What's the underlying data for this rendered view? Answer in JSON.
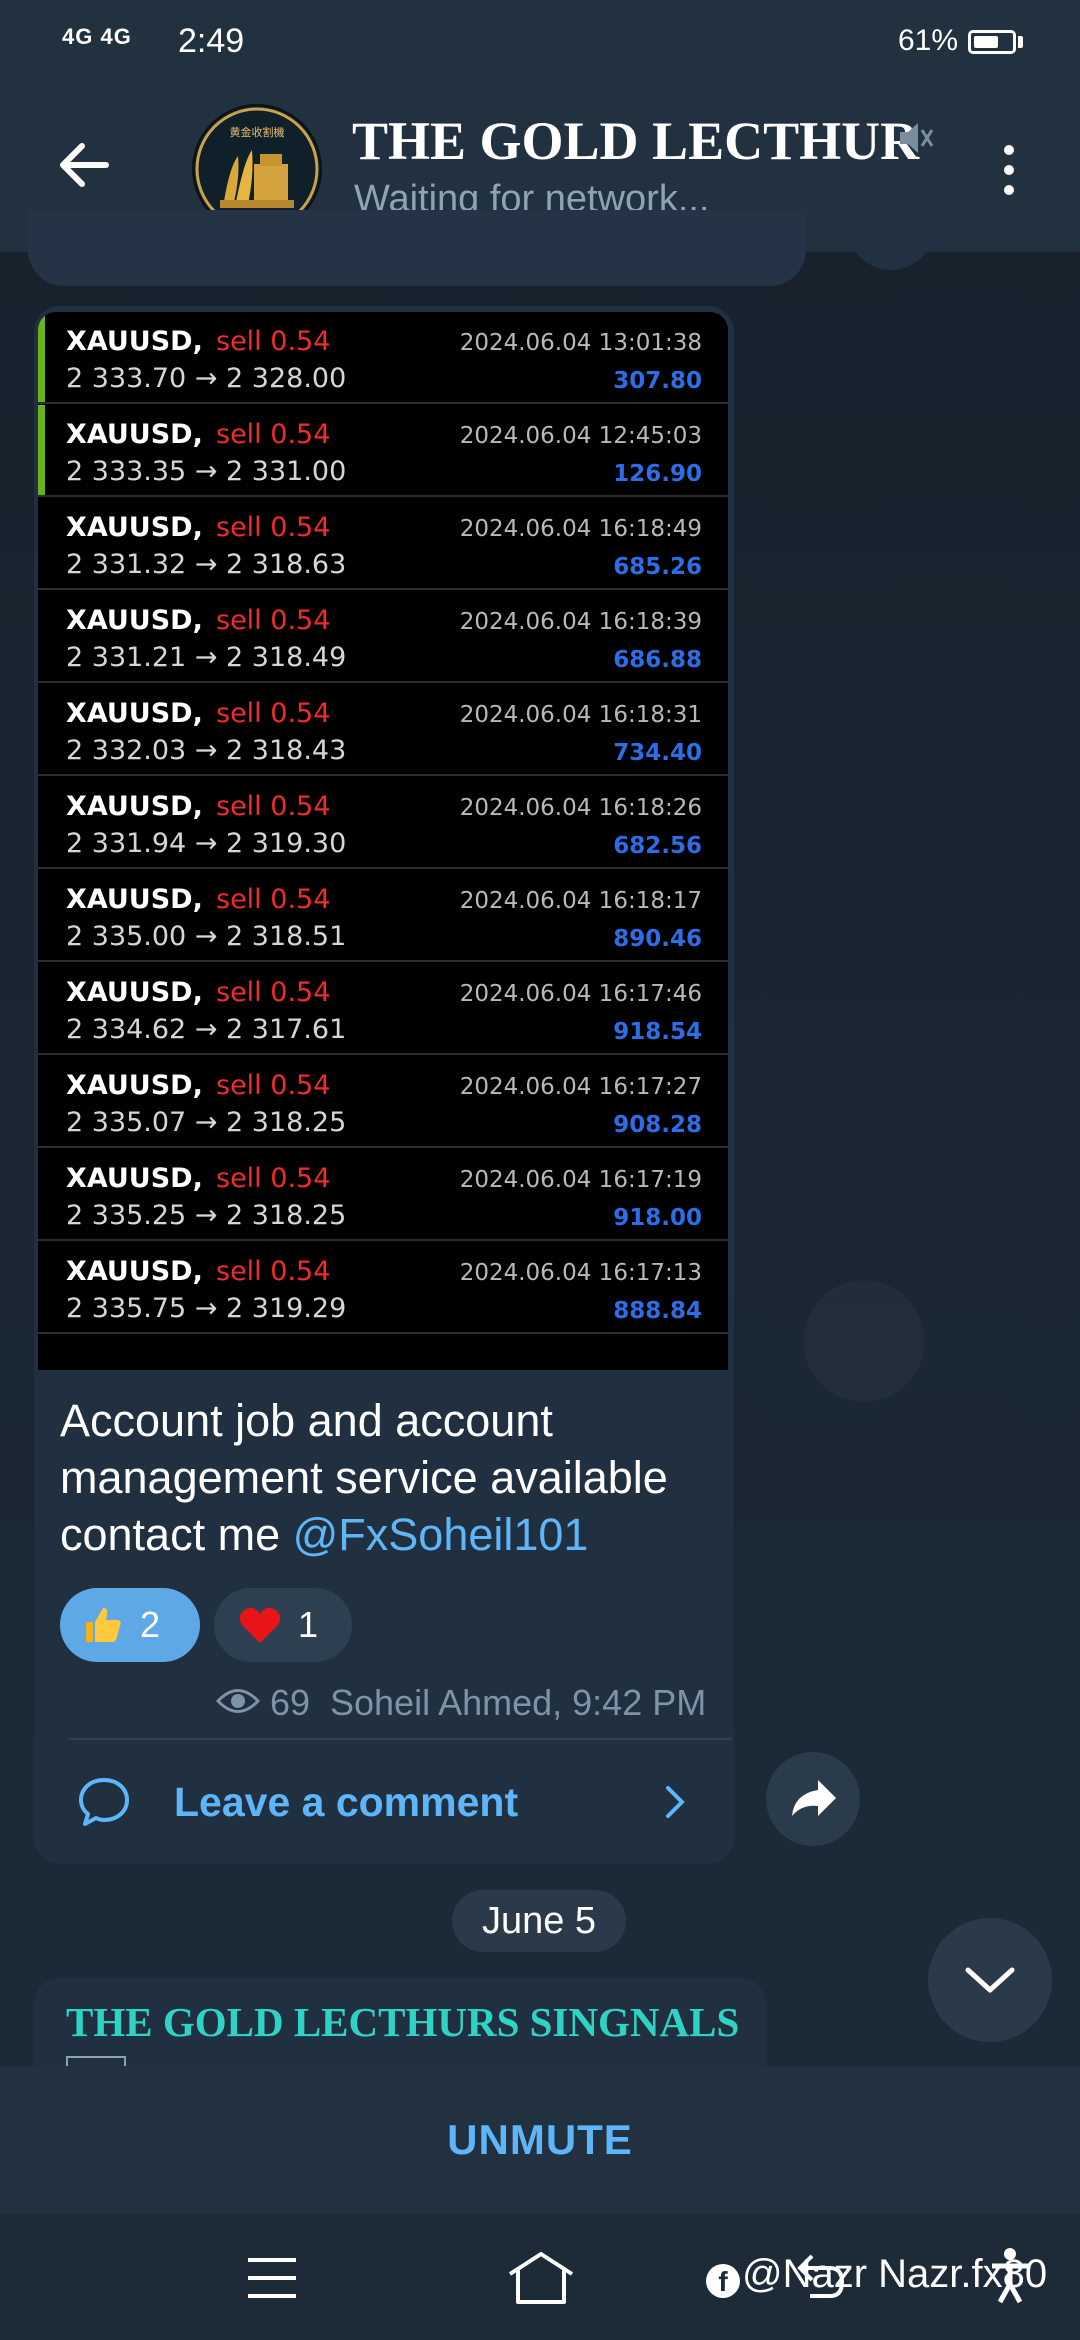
{
  "status_bar": {
    "network": "4G 4G",
    "time": "2:49",
    "battery_percent": "61%",
    "battery_level": 0.61
  },
  "header": {
    "channel_title": "THE GOLD LECTHURS",
    "channel_status": "Waiting for network...",
    "avatar_caption": "黄金收割機"
  },
  "trades": [
    {
      "symbol": "XAUUSD,",
      "side": "sell 0.54",
      "prices": "2 333.70 → 2 328.00",
      "time": "2024.06.04 13:01:38",
      "profit": "307.80",
      "marker": "green"
    },
    {
      "symbol": "XAUUSD,",
      "side": "sell 0.54",
      "prices": "2 333.35 → 2 331.00",
      "time": "2024.06.04 12:45:03",
      "profit": "126.90",
      "marker": "green"
    },
    {
      "symbol": "XAUUSD,",
      "side": "sell 0.54",
      "prices": "2 331.32 → 2 318.63",
      "time": "2024.06.04 16:18:49",
      "profit": "685.26",
      "marker": ""
    },
    {
      "symbol": "XAUUSD,",
      "side": "sell 0.54",
      "prices": "2 331.21 → 2 318.49",
      "time": "2024.06.04 16:18:39",
      "profit": "686.88",
      "marker": ""
    },
    {
      "symbol": "XAUUSD,",
      "side": "sell 0.54",
      "prices": "2 332.03 → 2 318.43",
      "time": "2024.06.04 16:18:31",
      "profit": "734.40",
      "marker": ""
    },
    {
      "symbol": "XAUUSD,",
      "side": "sell 0.54",
      "prices": "2 331.94 → 2 319.30",
      "time": "2024.06.04 16:18:26",
      "profit": "682.56",
      "marker": ""
    },
    {
      "symbol": "XAUUSD,",
      "side": "sell 0.54",
      "prices": "2 335.00 → 2 318.51",
      "time": "2024.06.04 16:18:17",
      "profit": "890.46",
      "marker": ""
    },
    {
      "symbol": "XAUUSD,",
      "side": "sell 0.54",
      "prices": "2 334.62 → 2 317.61",
      "time": "2024.06.04 16:17:46",
      "profit": "918.54",
      "marker": ""
    },
    {
      "symbol": "XAUUSD,",
      "side": "sell 0.54",
      "prices": "2 335.07 → 2 318.25",
      "time": "2024.06.04 16:17:27",
      "profit": "908.28",
      "marker": ""
    },
    {
      "symbol": "XAUUSD,",
      "side": "sell 0.54",
      "prices": "2 335.25 → 2 318.25",
      "time": "2024.06.04 16:17:19",
      "profit": "918.00",
      "marker": ""
    },
    {
      "symbol": "XAUUSD,",
      "side": "sell 0.54",
      "prices": "2 335.75 → 2 319.29",
      "time": "2024.06.04 16:17:13",
      "profit": "888.84",
      "marker": ""
    }
  ],
  "message": {
    "text": "Account job and account management service available contact me ",
    "mention": "@FxSoheil101",
    "reactions": [
      {
        "emoji": "thumbs-up",
        "count": "2"
      },
      {
        "emoji": "heart",
        "count": "1"
      }
    ],
    "views": "69",
    "author_time": "Soheil Ahmed, 9:42 PM",
    "comment_label": "Leave a comment"
  },
  "date_separator": "June 5",
  "next_message": {
    "title": "THE GOLD LECTHURS SINGNALS"
  },
  "bottom": {
    "unmute_label": "UNMUTE"
  },
  "watermark": {
    "text": "@Nazr Nazr.fx80"
  },
  "colors": {
    "header_bg": "#223140",
    "bubble_bg": "#203040",
    "accent_blue": "#5eb5f7",
    "sell_red": "#ef2b2b",
    "profit_blue": "#2c6ee8",
    "marker_green": "#6bb31b",
    "teal_title": "#2fd3c4"
  }
}
